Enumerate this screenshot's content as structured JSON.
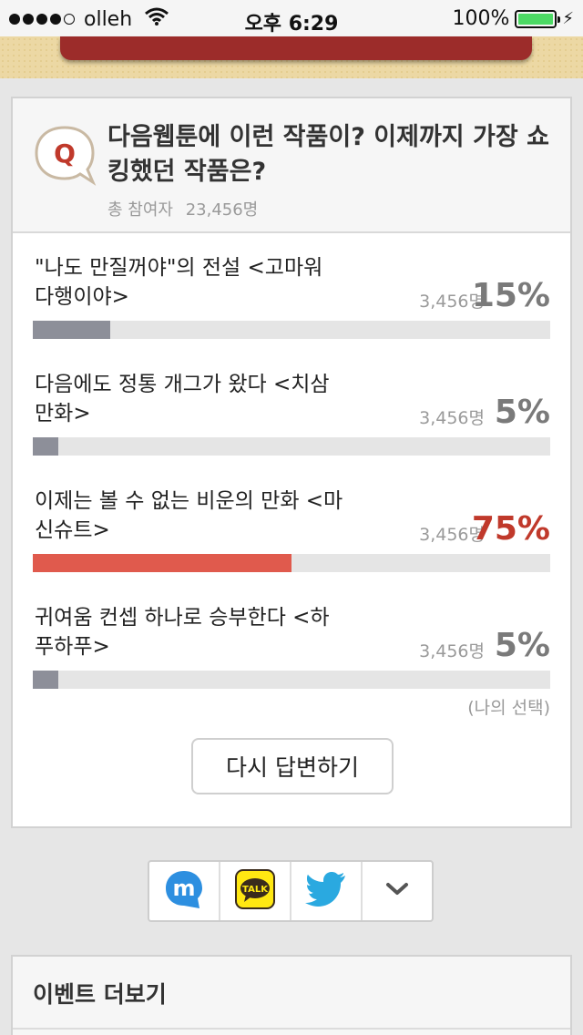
{
  "status_bar": {
    "carrier": "olleh",
    "time": "오후 6:29",
    "battery": "100%"
  },
  "question": {
    "badge": "Q",
    "title": "다음웹툰에 이런 작품이? 이제까지 가장 쇼킹했던 작품은?",
    "participants_label": "총 참여자",
    "participants_count": "23,456명"
  },
  "options": [
    {
      "text": "\"나도 만질꺼야\"의 전설 <고마워 다행이야>",
      "count": "3,456명",
      "percent_label": "15%",
      "percent": 15,
      "selected": false
    },
    {
      "text": "다음에도 정통 개그가 왔다 <치삼 만화>",
      "count": "3,456명",
      "percent_label": "5%",
      "percent": 5,
      "selected": false
    },
    {
      "text": "이제는 볼 수 없는 비운의 만화 <마신슈트>",
      "count": "3,456명",
      "percent_label": "75%",
      "percent": 50,
      "selected": true
    },
    {
      "text": "귀여움 컨셉 하나로 승부한다 <하푸하푸>",
      "count": "3,456명",
      "percent_label": "5%",
      "percent": 5,
      "selected": false
    }
  ],
  "my_choice_label": "(나의 선택)",
  "reanswer_label": "다시 답변하기",
  "share": {
    "items": [
      "mypeople-icon",
      "kakaotalk-icon",
      "twitter-icon",
      "chevron-down-icon"
    ],
    "kakao_label": "TALK"
  },
  "events": {
    "title": "이벤트 더보기"
  },
  "colors": {
    "accent": "#c0392b",
    "bar_selected": "#e05a4d",
    "bar_default": "#8d8f99",
    "header_band": "#9c2c2a"
  }
}
